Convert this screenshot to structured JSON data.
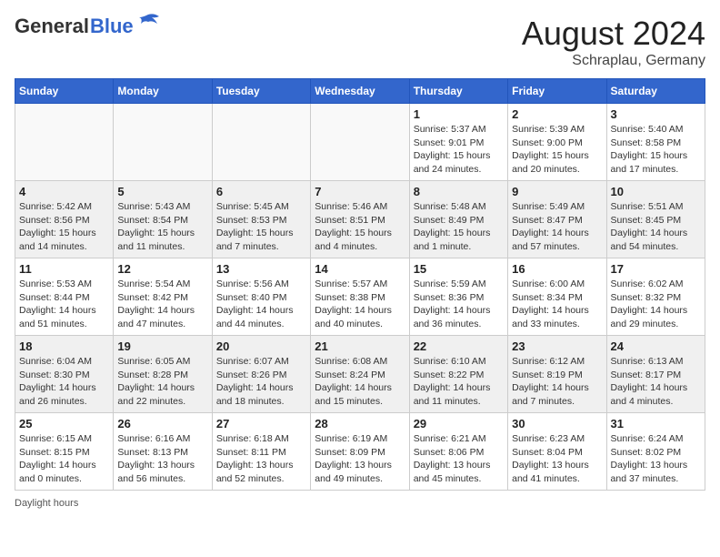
{
  "header": {
    "logo_general": "General",
    "logo_blue": "Blue",
    "month_year": "August 2024",
    "location": "Schraplau, Germany"
  },
  "days_of_week": [
    "Sunday",
    "Monday",
    "Tuesday",
    "Wednesday",
    "Thursday",
    "Friday",
    "Saturday"
  ],
  "weeks": [
    [
      {
        "day": "",
        "info": ""
      },
      {
        "day": "",
        "info": ""
      },
      {
        "day": "",
        "info": ""
      },
      {
        "day": "",
        "info": ""
      },
      {
        "day": "1",
        "info": "Sunrise: 5:37 AM\nSunset: 9:01 PM\nDaylight: 15 hours\nand 24 minutes."
      },
      {
        "day": "2",
        "info": "Sunrise: 5:39 AM\nSunset: 9:00 PM\nDaylight: 15 hours\nand 20 minutes."
      },
      {
        "day": "3",
        "info": "Sunrise: 5:40 AM\nSunset: 8:58 PM\nDaylight: 15 hours\nand 17 minutes."
      }
    ],
    [
      {
        "day": "4",
        "info": "Sunrise: 5:42 AM\nSunset: 8:56 PM\nDaylight: 15 hours\nand 14 minutes."
      },
      {
        "day": "5",
        "info": "Sunrise: 5:43 AM\nSunset: 8:54 PM\nDaylight: 15 hours\nand 11 minutes."
      },
      {
        "day": "6",
        "info": "Sunrise: 5:45 AM\nSunset: 8:53 PM\nDaylight: 15 hours\nand 7 minutes."
      },
      {
        "day": "7",
        "info": "Sunrise: 5:46 AM\nSunset: 8:51 PM\nDaylight: 15 hours\nand 4 minutes."
      },
      {
        "day": "8",
        "info": "Sunrise: 5:48 AM\nSunset: 8:49 PM\nDaylight: 15 hours\nand 1 minute."
      },
      {
        "day": "9",
        "info": "Sunrise: 5:49 AM\nSunset: 8:47 PM\nDaylight: 14 hours\nand 57 minutes."
      },
      {
        "day": "10",
        "info": "Sunrise: 5:51 AM\nSunset: 8:45 PM\nDaylight: 14 hours\nand 54 minutes."
      }
    ],
    [
      {
        "day": "11",
        "info": "Sunrise: 5:53 AM\nSunset: 8:44 PM\nDaylight: 14 hours\nand 51 minutes."
      },
      {
        "day": "12",
        "info": "Sunrise: 5:54 AM\nSunset: 8:42 PM\nDaylight: 14 hours\nand 47 minutes."
      },
      {
        "day": "13",
        "info": "Sunrise: 5:56 AM\nSunset: 8:40 PM\nDaylight: 14 hours\nand 44 minutes."
      },
      {
        "day": "14",
        "info": "Sunrise: 5:57 AM\nSunset: 8:38 PM\nDaylight: 14 hours\nand 40 minutes."
      },
      {
        "day": "15",
        "info": "Sunrise: 5:59 AM\nSunset: 8:36 PM\nDaylight: 14 hours\nand 36 minutes."
      },
      {
        "day": "16",
        "info": "Sunrise: 6:00 AM\nSunset: 8:34 PM\nDaylight: 14 hours\nand 33 minutes."
      },
      {
        "day": "17",
        "info": "Sunrise: 6:02 AM\nSunset: 8:32 PM\nDaylight: 14 hours\nand 29 minutes."
      }
    ],
    [
      {
        "day": "18",
        "info": "Sunrise: 6:04 AM\nSunset: 8:30 PM\nDaylight: 14 hours\nand 26 minutes."
      },
      {
        "day": "19",
        "info": "Sunrise: 6:05 AM\nSunset: 8:28 PM\nDaylight: 14 hours\nand 22 minutes."
      },
      {
        "day": "20",
        "info": "Sunrise: 6:07 AM\nSunset: 8:26 PM\nDaylight: 14 hours\nand 18 minutes."
      },
      {
        "day": "21",
        "info": "Sunrise: 6:08 AM\nSunset: 8:24 PM\nDaylight: 14 hours\nand 15 minutes."
      },
      {
        "day": "22",
        "info": "Sunrise: 6:10 AM\nSunset: 8:22 PM\nDaylight: 14 hours\nand 11 minutes."
      },
      {
        "day": "23",
        "info": "Sunrise: 6:12 AM\nSunset: 8:19 PM\nDaylight: 14 hours\nand 7 minutes."
      },
      {
        "day": "24",
        "info": "Sunrise: 6:13 AM\nSunset: 8:17 PM\nDaylight: 14 hours\nand 4 minutes."
      }
    ],
    [
      {
        "day": "25",
        "info": "Sunrise: 6:15 AM\nSunset: 8:15 PM\nDaylight: 14 hours\nand 0 minutes."
      },
      {
        "day": "26",
        "info": "Sunrise: 6:16 AM\nSunset: 8:13 PM\nDaylight: 13 hours\nand 56 minutes."
      },
      {
        "day": "27",
        "info": "Sunrise: 6:18 AM\nSunset: 8:11 PM\nDaylight: 13 hours\nand 52 minutes."
      },
      {
        "day": "28",
        "info": "Sunrise: 6:19 AM\nSunset: 8:09 PM\nDaylight: 13 hours\nand 49 minutes."
      },
      {
        "day": "29",
        "info": "Sunrise: 6:21 AM\nSunset: 8:06 PM\nDaylight: 13 hours\nand 45 minutes."
      },
      {
        "day": "30",
        "info": "Sunrise: 6:23 AM\nSunset: 8:04 PM\nDaylight: 13 hours\nand 41 minutes."
      },
      {
        "day": "31",
        "info": "Sunrise: 6:24 AM\nSunset: 8:02 PM\nDaylight: 13 hours\nand 37 minutes."
      }
    ]
  ],
  "legend": "Daylight hours"
}
